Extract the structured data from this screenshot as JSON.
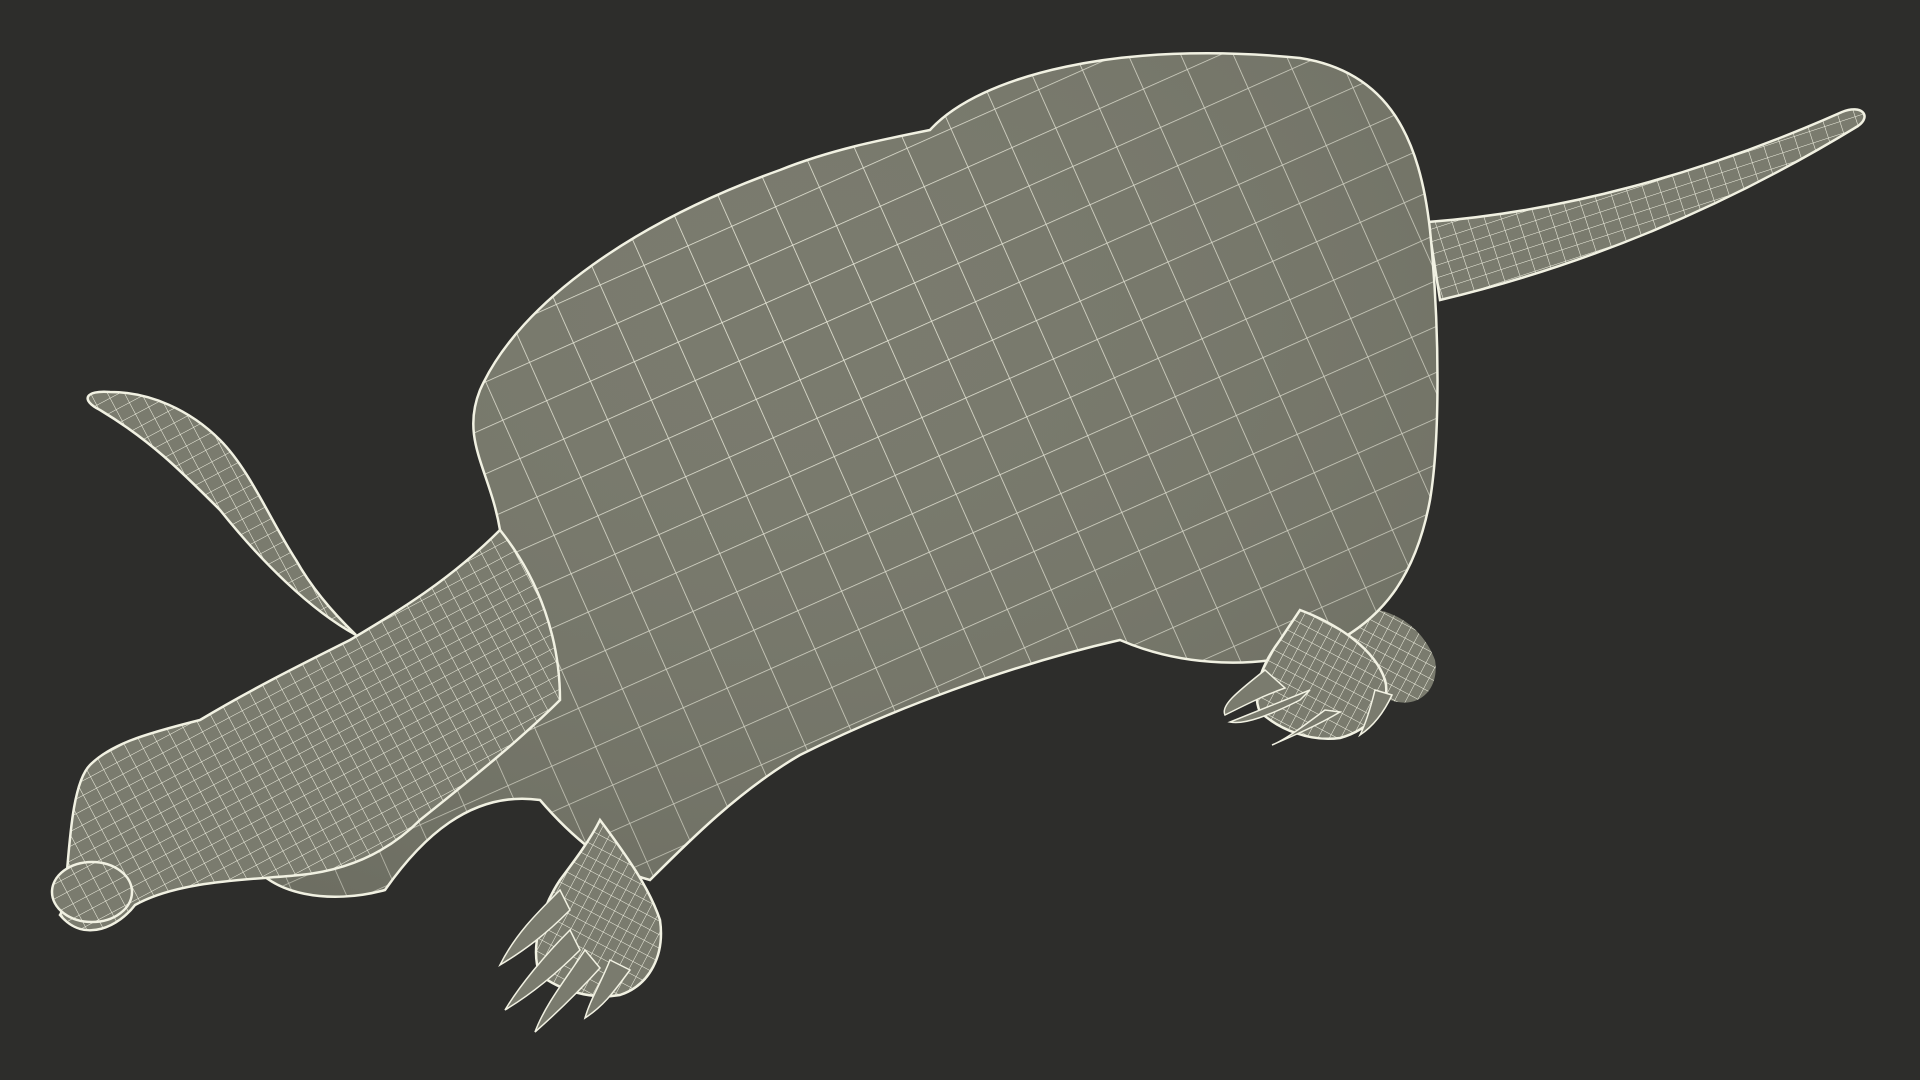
{
  "scene": {
    "subject": "aardvark-wireframe-model",
    "background_color": "#2d2d2b",
    "surface_color": "#7a7b6e",
    "wire_color": "#f1f1e2",
    "shade_color": "#55564c"
  }
}
